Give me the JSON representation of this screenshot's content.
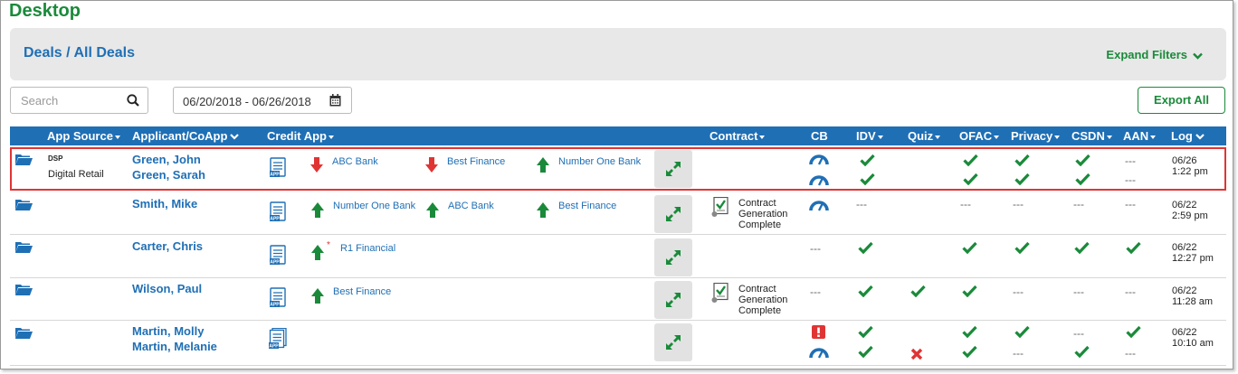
{
  "page": {
    "title": "Desktop"
  },
  "header": {
    "breadcrumb": "Deals / All Deals",
    "expand_filters_label": "Expand Filters"
  },
  "toolbar": {
    "search_placeholder": "Search",
    "date_range": "06/20/2018 - 06/26/2018",
    "export_label": "Export All"
  },
  "columns": {
    "app_source": "App Source",
    "applicant": "Applicant/CoApp",
    "credit_app": "Credit App",
    "contract": "Contract",
    "cb": "CB",
    "idv": "IDV",
    "quiz": "Quiz",
    "ofac": "OFAC",
    "privacy": "Privacy",
    "csdn": "CSDN",
    "aan": "AAN",
    "log": "Log"
  },
  "rows": [
    {
      "source_badge": "DSP",
      "source": "Digital Retail",
      "applicant": "Green, John",
      "coapplicant": "Green, Sarah",
      "lenders": [
        {
          "name": "ABC Bank",
          "direction": "down"
        },
        {
          "name": "Best Finance",
          "direction": "down"
        },
        {
          "name": "Number One Bank",
          "direction": "up"
        }
      ],
      "log_date": "06/26",
      "log_time": "1:22 pm"
    },
    {
      "applicant": "Smith, Mike",
      "lenders": [
        {
          "name": "Number One Bank",
          "direction": "up"
        },
        {
          "name": "ABC Bank",
          "direction": "up"
        },
        {
          "name": "Best Finance",
          "direction": "up"
        }
      ],
      "contract": "Contract Generation Complete",
      "dash": "---",
      "log_date": "06/22",
      "log_time": "2:59 pm"
    },
    {
      "applicant": "Carter, Chris",
      "lenders": [
        {
          "name": "R1 Financial",
          "direction": "up"
        }
      ],
      "star": "*",
      "dash": "---",
      "log_date": "06/22",
      "log_time": "12:27 pm"
    },
    {
      "applicant": "Wilson, Paul",
      "lenders": [
        {
          "name": "Best Finance",
          "direction": "up"
        }
      ],
      "contract": "Contract Generation Complete",
      "dash": "---",
      "log_date": "06/22",
      "log_time": "11:28 am"
    },
    {
      "applicant": "Martin, Molly",
      "coapplicant": "Martin, Melanie",
      "dash": "---",
      "log_date": "06/22",
      "log_time": "10:10 am"
    }
  ],
  "colors": {
    "brand_green": "#1a8a3a",
    "brand_blue": "#1f6fb5",
    "alert_red": "#e03434",
    "gauge_blue": "#1f6fb5"
  }
}
